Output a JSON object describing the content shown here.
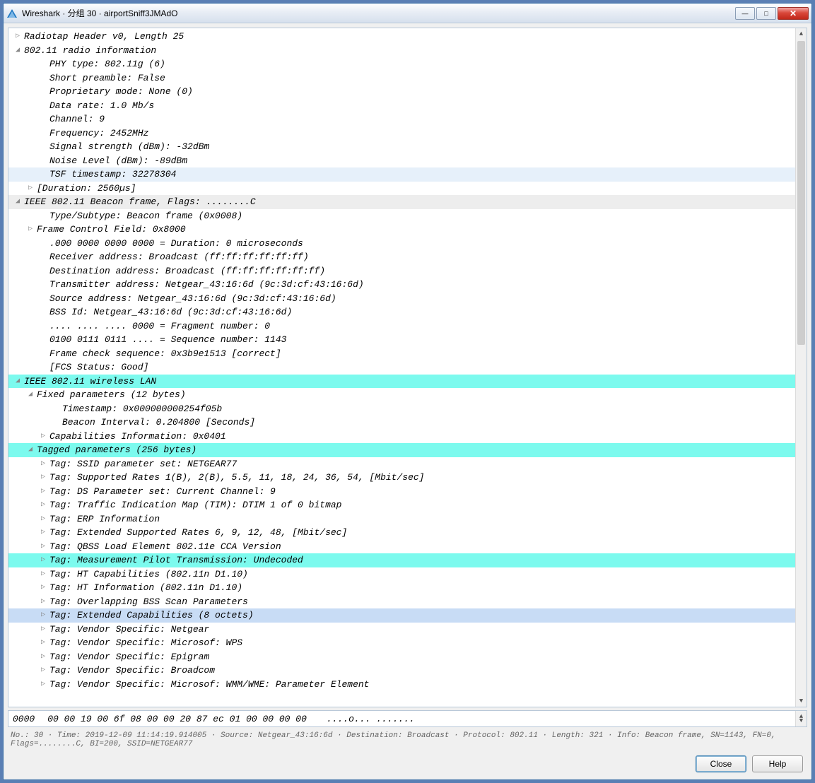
{
  "window": {
    "title": "Wireshark · 分组 30 · airportSniff3JMAdO"
  },
  "tree": [
    {
      "indent": 0,
      "arrow": "▷",
      "text": "Radiotap Header v0, Length 25",
      "cls": ""
    },
    {
      "indent": 0,
      "arrow": "◢",
      "text": "802.11 radio information",
      "cls": ""
    },
    {
      "indent": 2,
      "arrow": "",
      "text": "PHY type: 802.11g (6)",
      "cls": ""
    },
    {
      "indent": 2,
      "arrow": "",
      "text": "Short preamble: False",
      "cls": ""
    },
    {
      "indent": 2,
      "arrow": "",
      "text": "Proprietary mode: None (0)",
      "cls": ""
    },
    {
      "indent": 2,
      "arrow": "",
      "text": "Data rate: 1.0 Mb/s",
      "cls": ""
    },
    {
      "indent": 2,
      "arrow": "",
      "text": "Channel: 9",
      "cls": ""
    },
    {
      "indent": 2,
      "arrow": "",
      "text": "Frequency: 2452MHz",
      "cls": ""
    },
    {
      "indent": 2,
      "arrow": "",
      "text": "Signal strength (dBm): -32dBm",
      "cls": ""
    },
    {
      "indent": 2,
      "arrow": "",
      "text": "Noise Level (dBm): -89dBm",
      "cls": ""
    },
    {
      "indent": 2,
      "arrow": "",
      "text": "TSF timestamp: 32278304",
      "cls": "hl-blue"
    },
    {
      "indent": 1,
      "arrow": "▷",
      "text": "[Duration: 2560µs]",
      "cls": ""
    },
    {
      "indent": 0,
      "arrow": "◢",
      "text": "IEEE 802.11 Beacon frame, Flags: ........C",
      "cls": "hl-gray"
    },
    {
      "indent": 2,
      "arrow": "",
      "text": "Type/Subtype: Beacon frame (0x0008)",
      "cls": ""
    },
    {
      "indent": 1,
      "arrow": "▷",
      "text": "Frame Control Field: 0x8000",
      "cls": ""
    },
    {
      "indent": 2,
      "arrow": "",
      "text": ".000 0000 0000 0000 = Duration: 0 microseconds",
      "cls": ""
    },
    {
      "indent": 2,
      "arrow": "",
      "text": "Receiver address: Broadcast (ff:ff:ff:ff:ff:ff)",
      "cls": ""
    },
    {
      "indent": 2,
      "arrow": "",
      "text": "Destination address: Broadcast (ff:ff:ff:ff:ff:ff)",
      "cls": ""
    },
    {
      "indent": 2,
      "arrow": "",
      "text": "Transmitter address: Netgear_43:16:6d (9c:3d:cf:43:16:6d)",
      "cls": ""
    },
    {
      "indent": 2,
      "arrow": "",
      "text": "Source address: Netgear_43:16:6d (9c:3d:cf:43:16:6d)",
      "cls": ""
    },
    {
      "indent": 2,
      "arrow": "",
      "text": "BSS Id: Netgear_43:16:6d (9c:3d:cf:43:16:6d)",
      "cls": ""
    },
    {
      "indent": 2,
      "arrow": "",
      "text": ".... .... .... 0000 = Fragment number: 0",
      "cls": ""
    },
    {
      "indent": 2,
      "arrow": "",
      "text": "0100 0111 0111 .... = Sequence number: 1143",
      "cls": ""
    },
    {
      "indent": 2,
      "arrow": "",
      "text": "Frame check sequence: 0x3b9e1513 [correct]",
      "cls": ""
    },
    {
      "indent": 2,
      "arrow": "",
      "text": "[FCS Status: Good]",
      "cls": ""
    },
    {
      "indent": 0,
      "arrow": "◢",
      "text": "IEEE 802.11 wireless LAN",
      "cls": "hl-cyan"
    },
    {
      "indent": 1,
      "arrow": "◢",
      "text": "Fixed parameters (12 bytes)",
      "cls": ""
    },
    {
      "indent": 3,
      "arrow": "",
      "text": "Timestamp: 0x000000000254f05b",
      "cls": ""
    },
    {
      "indent": 3,
      "arrow": "",
      "text": "Beacon Interval: 0.204800 [Seconds]",
      "cls": ""
    },
    {
      "indent": 2,
      "arrow": "▷",
      "text": "Capabilities Information: 0x0401",
      "cls": ""
    },
    {
      "indent": 1,
      "arrow": "◢",
      "text": "Tagged parameters (256 bytes)",
      "cls": "hl-cyan"
    },
    {
      "indent": 2,
      "arrow": "▷",
      "text": "Tag: SSID parameter set: NETGEAR77",
      "cls": ""
    },
    {
      "indent": 2,
      "arrow": "▷",
      "text": "Tag: Supported Rates 1(B), 2(B), 5.5, 11, 18, 24, 36, 54, [Mbit/sec]",
      "cls": ""
    },
    {
      "indent": 2,
      "arrow": "▷",
      "text": "Tag: DS Parameter set: Current Channel: 9",
      "cls": ""
    },
    {
      "indent": 2,
      "arrow": "▷",
      "text": "Tag: Traffic Indication Map (TIM): DTIM 1 of 0 bitmap",
      "cls": ""
    },
    {
      "indent": 2,
      "arrow": "▷",
      "text": "Tag: ERP Information",
      "cls": ""
    },
    {
      "indent": 2,
      "arrow": "▷",
      "text": "Tag: Extended Supported Rates 6, 9, 12, 48, [Mbit/sec]",
      "cls": ""
    },
    {
      "indent": 2,
      "arrow": "▷",
      "text": "Tag: QBSS Load Element 802.11e CCA Version",
      "cls": ""
    },
    {
      "indent": 2,
      "arrow": "▷",
      "text": "Tag: Measurement Pilot Transmission: Undecoded",
      "cls": "hl-cyan"
    },
    {
      "indent": 2,
      "arrow": "▷",
      "text": "Tag: HT Capabilities (802.11n D1.10)",
      "cls": ""
    },
    {
      "indent": 2,
      "arrow": "▷",
      "text": "Tag: HT Information (802.11n D1.10)",
      "cls": ""
    },
    {
      "indent": 2,
      "arrow": "▷",
      "text": "Tag: Overlapping BSS Scan Parameters",
      "cls": ""
    },
    {
      "indent": 2,
      "arrow": "▷",
      "text": "Tag: Extended Capabilities (8 octets)",
      "cls": "hl-lightblue"
    },
    {
      "indent": 2,
      "arrow": "▷",
      "text": "Tag: Vendor Specific: Netgear",
      "cls": ""
    },
    {
      "indent": 2,
      "arrow": "▷",
      "text": "Tag: Vendor Specific: Microsof: WPS",
      "cls": ""
    },
    {
      "indent": 2,
      "arrow": "▷",
      "text": "Tag: Vendor Specific: Epigram",
      "cls": ""
    },
    {
      "indent": 2,
      "arrow": "▷",
      "text": "Tag: Vendor Specific: Broadcom",
      "cls": ""
    },
    {
      "indent": 2,
      "arrow": "▷",
      "text": "Tag: Vendor Specific: Microsof: WMM/WME: Parameter Element",
      "cls": ""
    }
  ],
  "hex": {
    "offset": "0000",
    "bytes": "00 00 19 00 6f 08 00 00  20 87 ec 01 00 00 00 00",
    "ascii": "....o... ......."
  },
  "status": "No.: 30 · Time: 2019-12-09 11:14:19.914005 · Source: Netgear_43:16:6d · Destination: Broadcast · Protocol: 802.11 · Length: 321 · Info: Beacon frame, SN=1143, FN=0, Flags=........C, BI=200, SSID=NETGEAR77",
  "buttons": {
    "close": "Close",
    "help": "Help"
  },
  "icons": {
    "min": "—",
    "max": "□",
    "close": "✕"
  }
}
